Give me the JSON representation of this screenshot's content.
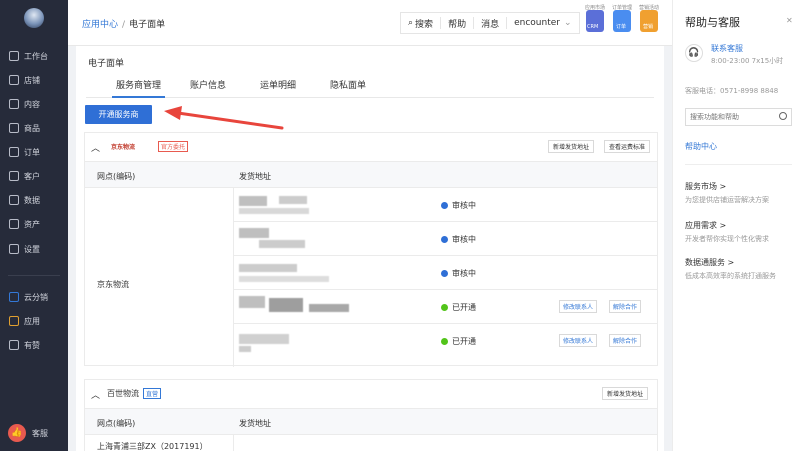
{
  "nav": {
    "items": [
      {
        "label": "工作台",
        "icon": "monitor-icon"
      },
      {
        "label": "店铺",
        "icon": "store-icon"
      },
      {
        "label": "内容",
        "icon": "content-icon"
      },
      {
        "label": "商品",
        "icon": "product-icon"
      },
      {
        "label": "订单",
        "icon": "order-icon"
      },
      {
        "label": "客户",
        "icon": "customer-icon"
      },
      {
        "label": "数据",
        "icon": "data-icon"
      },
      {
        "label": "资产",
        "icon": "asset-icon"
      },
      {
        "label": "设置",
        "icon": "settings-icon"
      }
    ],
    "items2": [
      {
        "label": "云分销",
        "icon": "cloud-distribution-icon"
      },
      {
        "label": "应用",
        "icon": "apps-icon"
      },
      {
        "label": "有赞",
        "icon": "like-icon"
      }
    ],
    "service": "客服"
  },
  "topbar": {
    "crumb_root": "应用中心",
    "crumb_sep": "/",
    "crumb_current": "电子面单",
    "search": "搜索",
    "help": "帮助",
    "messages": "消息",
    "user": "encounter",
    "apps": [
      {
        "caption": "应用市场",
        "badge": "CRM",
        "color": "#5b6fd8"
      },
      {
        "caption": "订单管理",
        "badge": "订单",
        "color": "#4a8df0"
      },
      {
        "caption": "营销活动",
        "badge": "营销",
        "color": "#f0a030"
      }
    ]
  },
  "page": {
    "title": "电子面单",
    "tabs": [
      "服务商管理",
      "账户信息",
      "运单明细",
      "隐私面单"
    ],
    "open_button": "开通服务商"
  },
  "carrier1": {
    "logo_text": "京东物流",
    "tag": "官方委托",
    "btn_add": "新增发货地址",
    "btn_fee": "查看运费标准",
    "col_site": "网点(编码)",
    "col_addr": "发货地址",
    "site_name": "京东物流",
    "rows": [
      {
        "status": "审核中",
        "state": "review"
      },
      {
        "status": "审核中",
        "state": "review"
      },
      {
        "status": "审核中",
        "state": "review"
      },
      {
        "status": "已开通",
        "state": "open",
        "btn_contact": "修改联系人",
        "btn_cancel": "解除合作"
      },
      {
        "status": "已开通",
        "state": "open",
        "btn_contact": "修改联系人",
        "btn_cancel": "解除合作"
      }
    ]
  },
  "carrier2": {
    "name": "百世物流",
    "tag": "直营",
    "btn_add": "新增发货地址",
    "col_site": "网点(编码)",
    "col_addr": "发货地址",
    "first_row": "上海青浦三部ZX（2017191）"
  },
  "right": {
    "title": "帮助与客服",
    "contact_label": "联系客服",
    "hours": "8:00-23:00 7x15小时",
    "phone": "客服电话：0571-8998 8848",
    "search_placeholder": "搜索功能和帮助",
    "help_center": "帮助中心",
    "sections": [
      {
        "title": "服务市场 >",
        "desc": "为您提供店铺运营解决方案"
      },
      {
        "title": "应用需求 >",
        "desc": "开发者帮你实现个性化需求"
      },
      {
        "title": "数据通服务 >",
        "desc": "低成本高效率的系统打通服务"
      }
    ]
  }
}
